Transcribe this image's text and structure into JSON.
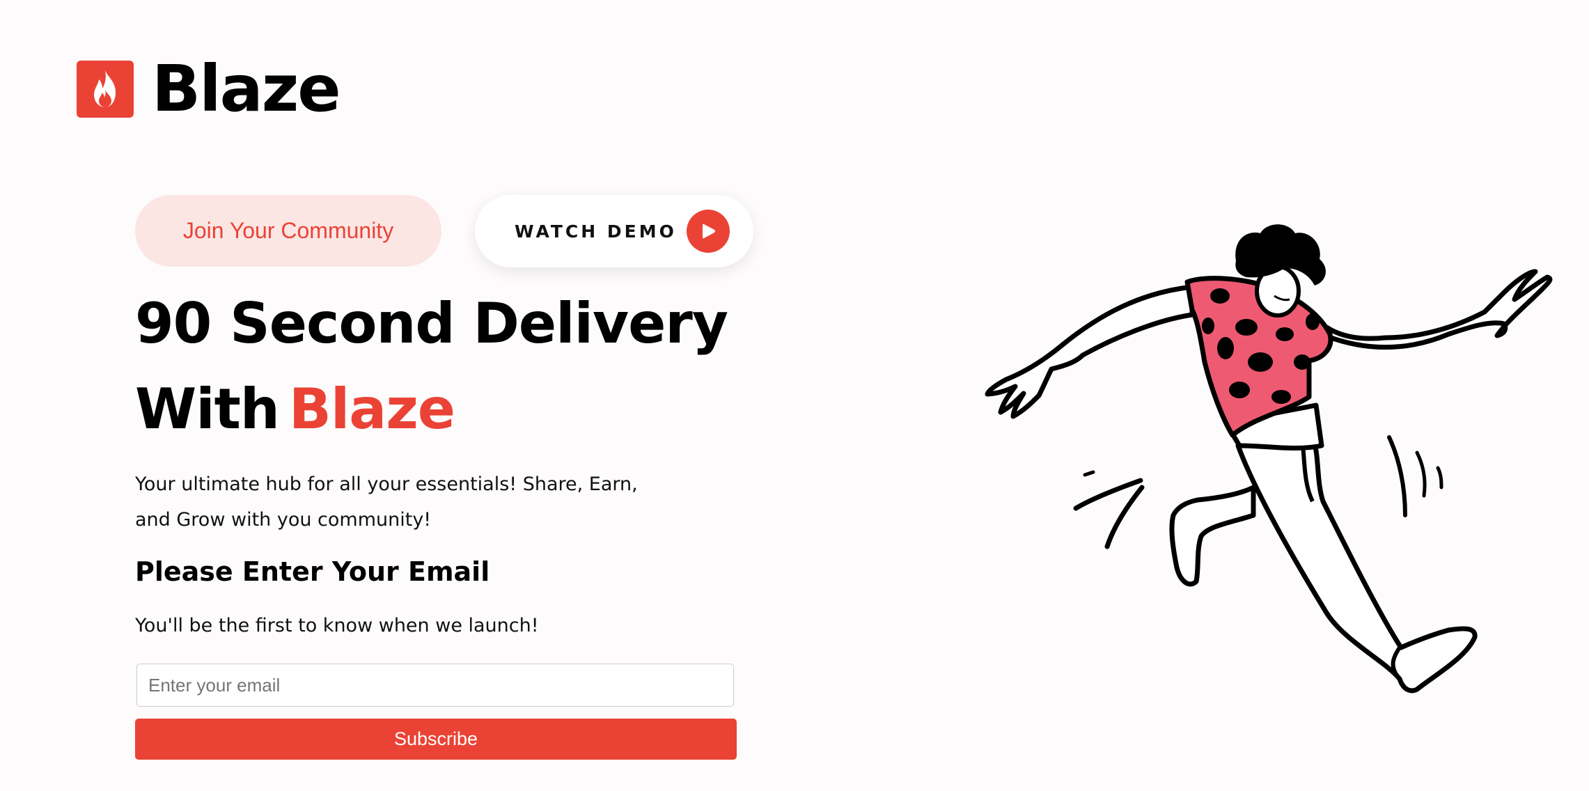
{
  "brand": {
    "name": "Blaze",
    "accent_color": "#ea4335",
    "logo_icon": "flame-icon"
  },
  "hero": {
    "community_label": "Join Your Community",
    "watch_demo_label": "WATCH DEMO",
    "play_icon": "play-icon",
    "headline_line1": "90 Second Delivery",
    "headline_line2_prefix": "With",
    "headline_brand": "Blaze",
    "description": "Your ultimate hub for all your essentials! Share, Earn, and Grow with you community!"
  },
  "signup": {
    "heading": "Please Enter Your Email",
    "subtext": "You'll be the first to know when we launch!",
    "email_value": "",
    "email_placeholder": "Enter your email",
    "subscribe_label": "Subscribe"
  },
  "illustration": {
    "name": "jumping-person-illustration",
    "shirt_color": "#ee5a72"
  }
}
